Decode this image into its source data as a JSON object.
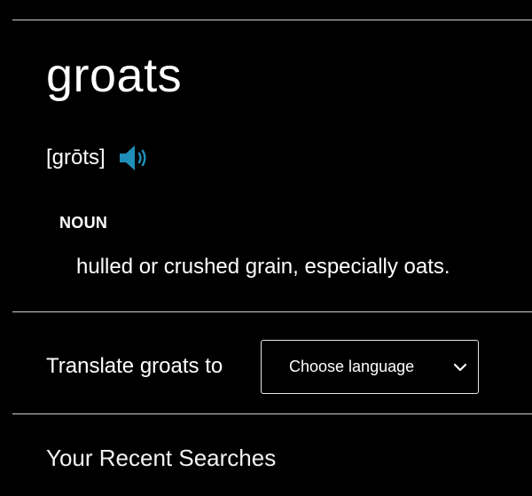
{
  "entry": {
    "headword": "groats",
    "pronunciation": "[grōts]",
    "speaker_icon": "speaker-volume-icon",
    "part_of_speech": "NOUN",
    "definition": "hulled or crushed grain, especially oats."
  },
  "translate": {
    "label": "Translate groats to",
    "select_value": "Choose language",
    "select_icon": "chevron-down-icon"
  },
  "recent": {
    "title": "Your Recent Searches"
  },
  "colors": {
    "background": "#000000",
    "text": "#ffffff",
    "speaker_accent": "#1f8fb8",
    "divider": "#cfcfcf"
  }
}
